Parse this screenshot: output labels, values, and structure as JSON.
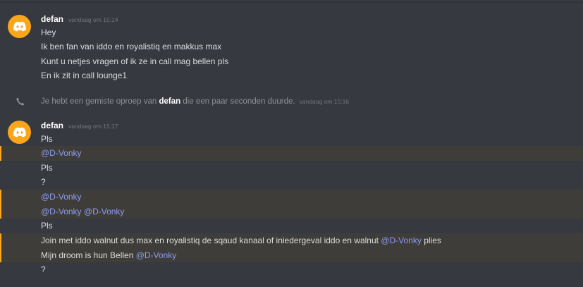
{
  "groups": [
    {
      "username": "defan",
      "timestamp": "vandaag om 15:14",
      "lines": [
        "Hey",
        "Ik ben fan van iddo en royalistiq en makkus max",
        "Kunt u netjes vragen of ik ze in call mag bellen pls",
        "En ik zit in call lounge1"
      ]
    },
    {
      "username": "defan",
      "timestamp": "vandaag om 15:17",
      "lines": [
        "Pls",
        "@D-Vonky",
        "Pls",
        "?",
        "@D-Vonky",
        "@D-Vonky",
        "@D-Vonky",
        "Pls",
        "Join met iddo walnut dus max en royalistiq de sqaud kanaal of iniedergeval iddo en walnut",
        "@D-Vonky",
        "plies",
        "Mijn droom is hun Bellen",
        "@D-Vonky",
        "?"
      ]
    }
  ],
  "system_message": {
    "prefix": "Je hebt een gemiste oproep van",
    "caller": "defan",
    "suffix": "die een paar seconden duurde.",
    "timestamp": "vandaag om 15:16",
    "icon": "phone-missed-icon"
  },
  "colors": {
    "background": "#36393f",
    "avatar": "#faa61a",
    "mention": "#8e9cf4",
    "mention_highlight": "#3e3d39",
    "mention_bar": "#faa61a"
  }
}
